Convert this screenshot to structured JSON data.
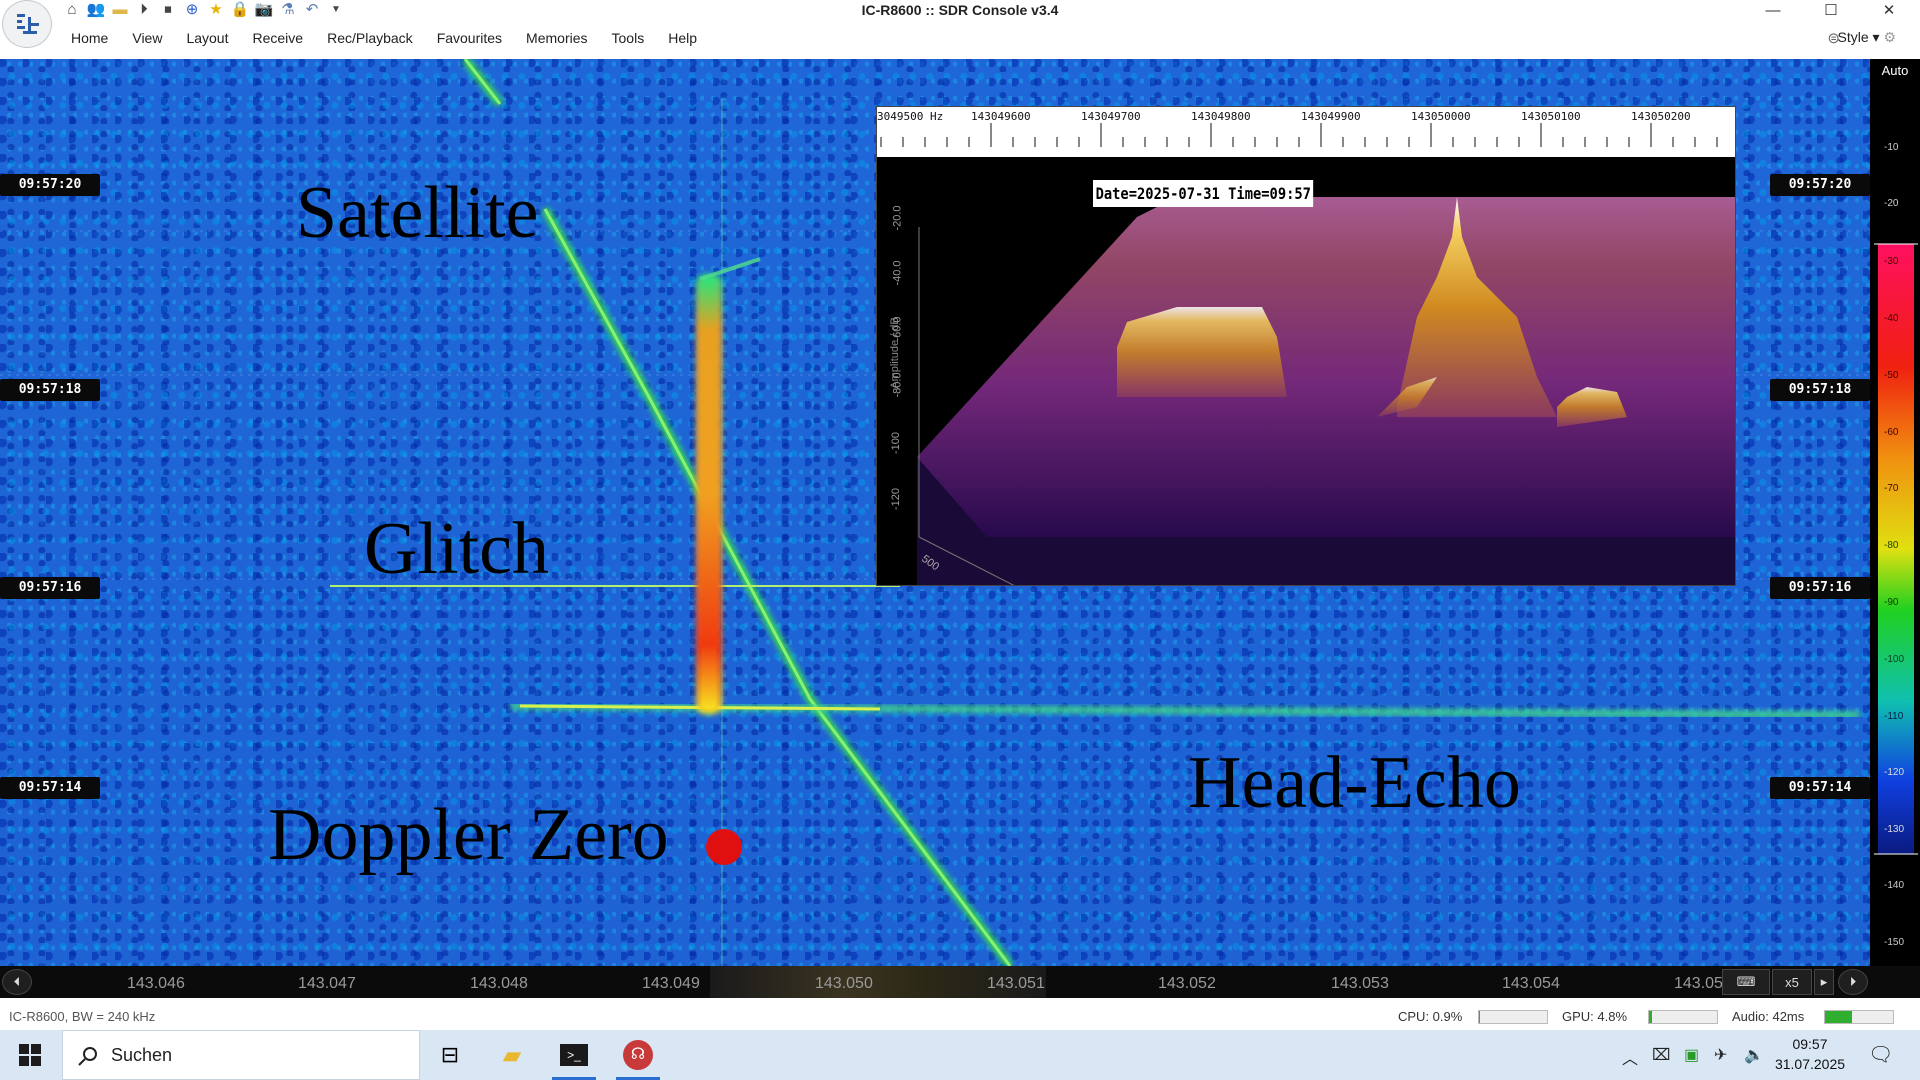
{
  "window": {
    "title": "IC-R8600 :: SDR Console v3.4",
    "controls": [
      "minimize-icon",
      "maximize-icon",
      "close-icon"
    ]
  },
  "quick_access": [
    "home-icon",
    "users-icon",
    "folder-icon",
    "play-icon",
    "stop-icon",
    "plus-icon",
    "star-icon",
    "lock-icon",
    "camera-icon",
    "flask-icon",
    "undo-icon",
    "dropdown-icon"
  ],
  "menu": {
    "items": [
      "Home",
      "View",
      "Layout",
      "Receive",
      "Rec/Playback",
      "Favourites",
      "Memories",
      "Tools",
      "Help"
    ],
    "style_label": "Style"
  },
  "waterfall": {
    "time_labels": [
      "09:57:20",
      "09:57:18",
      "09:57:16",
      "09:57:14"
    ],
    "annotations": {
      "satellite": "Satellite",
      "glitch": "Glitch",
      "doppler_zero": "Doppler Zero",
      "head_echo": "Head-Echo"
    }
  },
  "inset": {
    "ruler_ticks": [
      "3049500 Hz",
      "143049600",
      "143049700",
      "143049800",
      "143049900",
      "143050000",
      "143050100",
      "143050200"
    ],
    "date_time": "Date=2025-07-31 Time=09:57",
    "y_axis_label": "Amplitude / dB",
    "y_ticks": [
      "-20.0",
      "-40.0",
      "-60.0",
      "-80.0",
      "-100",
      "-120"
    ],
    "x_corner_label": "500"
  },
  "color_scale": {
    "mode": "Auto",
    "ticks": [
      "-10",
      "-20",
      "-30",
      "-40",
      "-50",
      "-60",
      "-70",
      "-80",
      "-90",
      "-100",
      "-110",
      "-120",
      "-130",
      "-140",
      "-150"
    ]
  },
  "frequency_axis": {
    "ticks": [
      "143.046",
      "143.047",
      "143.048",
      "143.049",
      "143.050",
      "143.051",
      "143.052",
      "143.053",
      "143.054",
      "143.05"
    ],
    "zoom": "x5"
  },
  "status": {
    "device": "IC-R8600, BW = 240 kHz",
    "cpu": "CPU: 0.9%",
    "cpu_level": 0.009,
    "gpu": "GPU: 4.8%",
    "gpu_level": 0.048,
    "audio": "Audio: 42ms",
    "audio_level": 0.4
  },
  "taskbar": {
    "search_placeholder": "Suchen",
    "time": "09:57",
    "date": "31.07.2025"
  }
}
